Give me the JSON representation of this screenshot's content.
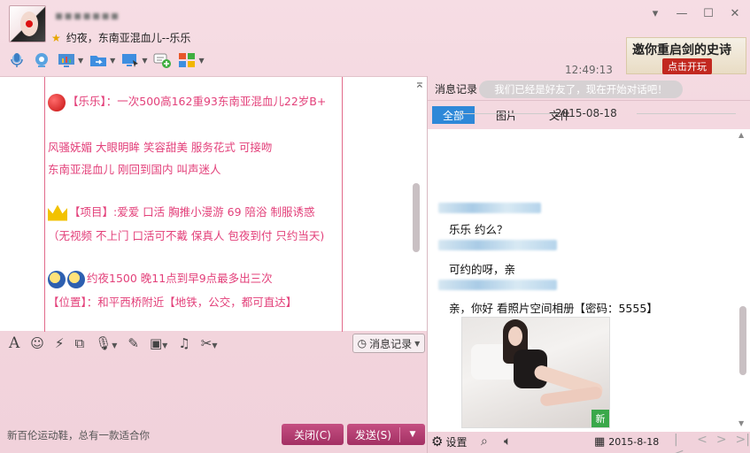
{
  "window": {
    "nickname": "▪▪▪▪▪▪▪",
    "signature": "约夜，东南亚混血儿--乐乐",
    "buttons": {
      "menu": "▾",
      "minimize": "—",
      "maximize": "☐",
      "close": "✕"
    }
  },
  "toolbar": {
    "icons": [
      "microphone-icon",
      "video-camera-icon",
      "screen-share-icon",
      "file-transfer-icon",
      "remote-desktop-icon",
      "create-group-icon",
      "apps-icon"
    ]
  },
  "banner": {
    "title": "邀你重启剑的史诗",
    "cta": "点击开玩"
  },
  "chat": {
    "lines": [
      {
        "icon": "apple",
        "text": "【乐乐】：一次500高162重93东南亚混血儿22岁B+"
      },
      {
        "icon": "",
        "text": "风骚妩媚 大眼明眸  笑容甜美 服务花式 可接吻"
      },
      {
        "icon": "",
        "text": "东南亚混血儿  刚回到国内  叫声迷人"
      },
      {
        "icon": "crown",
        "text": "【项目】:爱爱 口活 胸推小漫游 69 陪浴 制服诱惑"
      },
      {
        "icon": "",
        "text": "（无视频 不上门 口活可不戴 保真人 包夜到付 只约当天)"
      },
      {
        "icon": "moon2",
        "text": "约夜1500 晚11点到早9点最多出三次"
      },
      {
        "icon": "",
        "text": "【位置】：和平西桥附近【地铁，公交，都可直达】"
      }
    ]
  },
  "input": {
    "history_button": "消息记录",
    "ad_text": "新百伦运动鞋，总有一款适合你",
    "close_button": "关闭(C)",
    "send_button": "发送(S)"
  },
  "history": {
    "tab_title": "消息记录",
    "filters": [
      "全部",
      "图片",
      "文件"
    ],
    "active_filter": 0,
    "time": "12:49:13",
    "system_message": "我们已经是好友了，现在开始对话吧！",
    "date_separator": "2015-08-18",
    "messages": [
      "乐乐 约么？",
      "可约的呀，亲",
      "亲，你好 看照片空间相册【密码：5555】"
    ],
    "photo_badge": "新",
    "footer": {
      "settings": "设置",
      "date": "2015-8-18"
    }
  },
  "colors": {
    "accent": "#2e88d8",
    "pink_text": "#e3407a",
    "button": "#b13d70"
  }
}
